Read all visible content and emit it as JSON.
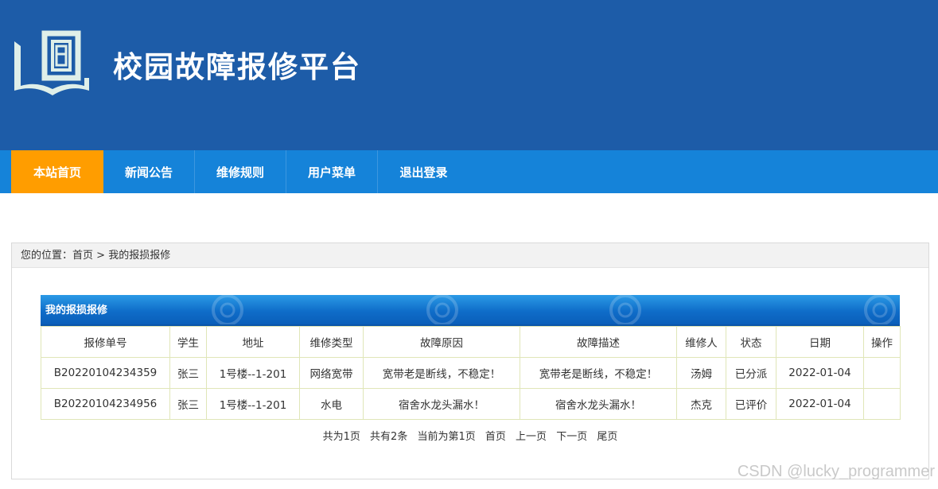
{
  "header": {
    "title": "校园故障报修平台"
  },
  "nav": {
    "items": [
      {
        "label": "本站首页",
        "active": true
      },
      {
        "label": "新闻公告",
        "active": false
      },
      {
        "label": "维修规则",
        "active": false
      },
      {
        "label": "用户菜单",
        "active": false
      },
      {
        "label": "退出登录",
        "active": false
      }
    ]
  },
  "breadcrumb": {
    "prefix": "您的位置：",
    "home": "首页",
    "separator": " > ",
    "current": "我的报损报修"
  },
  "table": {
    "title": "我的报损报修",
    "columns": [
      "报修单号",
      "学生",
      "地址",
      "维修类型",
      "故障原因",
      "故障描述",
      "维修人",
      "状态",
      "日期",
      "操作"
    ],
    "rows": [
      [
        "B20220104234359",
        "张三",
        "1号楼--1-201",
        "网络宽带",
        "宽带老是断线，不稳定！",
        "宽带老是断线，不稳定！",
        "汤姆",
        "已分派",
        "2022-01-04",
        ""
      ],
      [
        "B20220104234956",
        "张三",
        "1号楼--1-201",
        "水电",
        "宿舍水龙头漏水！",
        "宿舍水龙头漏水！",
        "杰克",
        "已评价",
        "2022-01-04",
        ""
      ]
    ]
  },
  "pager": {
    "total_pages": "共为1页",
    "total_records": "共有2条",
    "current_page": "当前为第1页",
    "first": "首页",
    "prev": "上一页",
    "next": "下一页",
    "last": "尾页"
  },
  "watermark": "CSDN @lucky_programmer",
  "colors": {
    "header_bg": "#1d5ca8",
    "nav_bg": "#1583d9",
    "nav_active": "#ff9d00"
  }
}
